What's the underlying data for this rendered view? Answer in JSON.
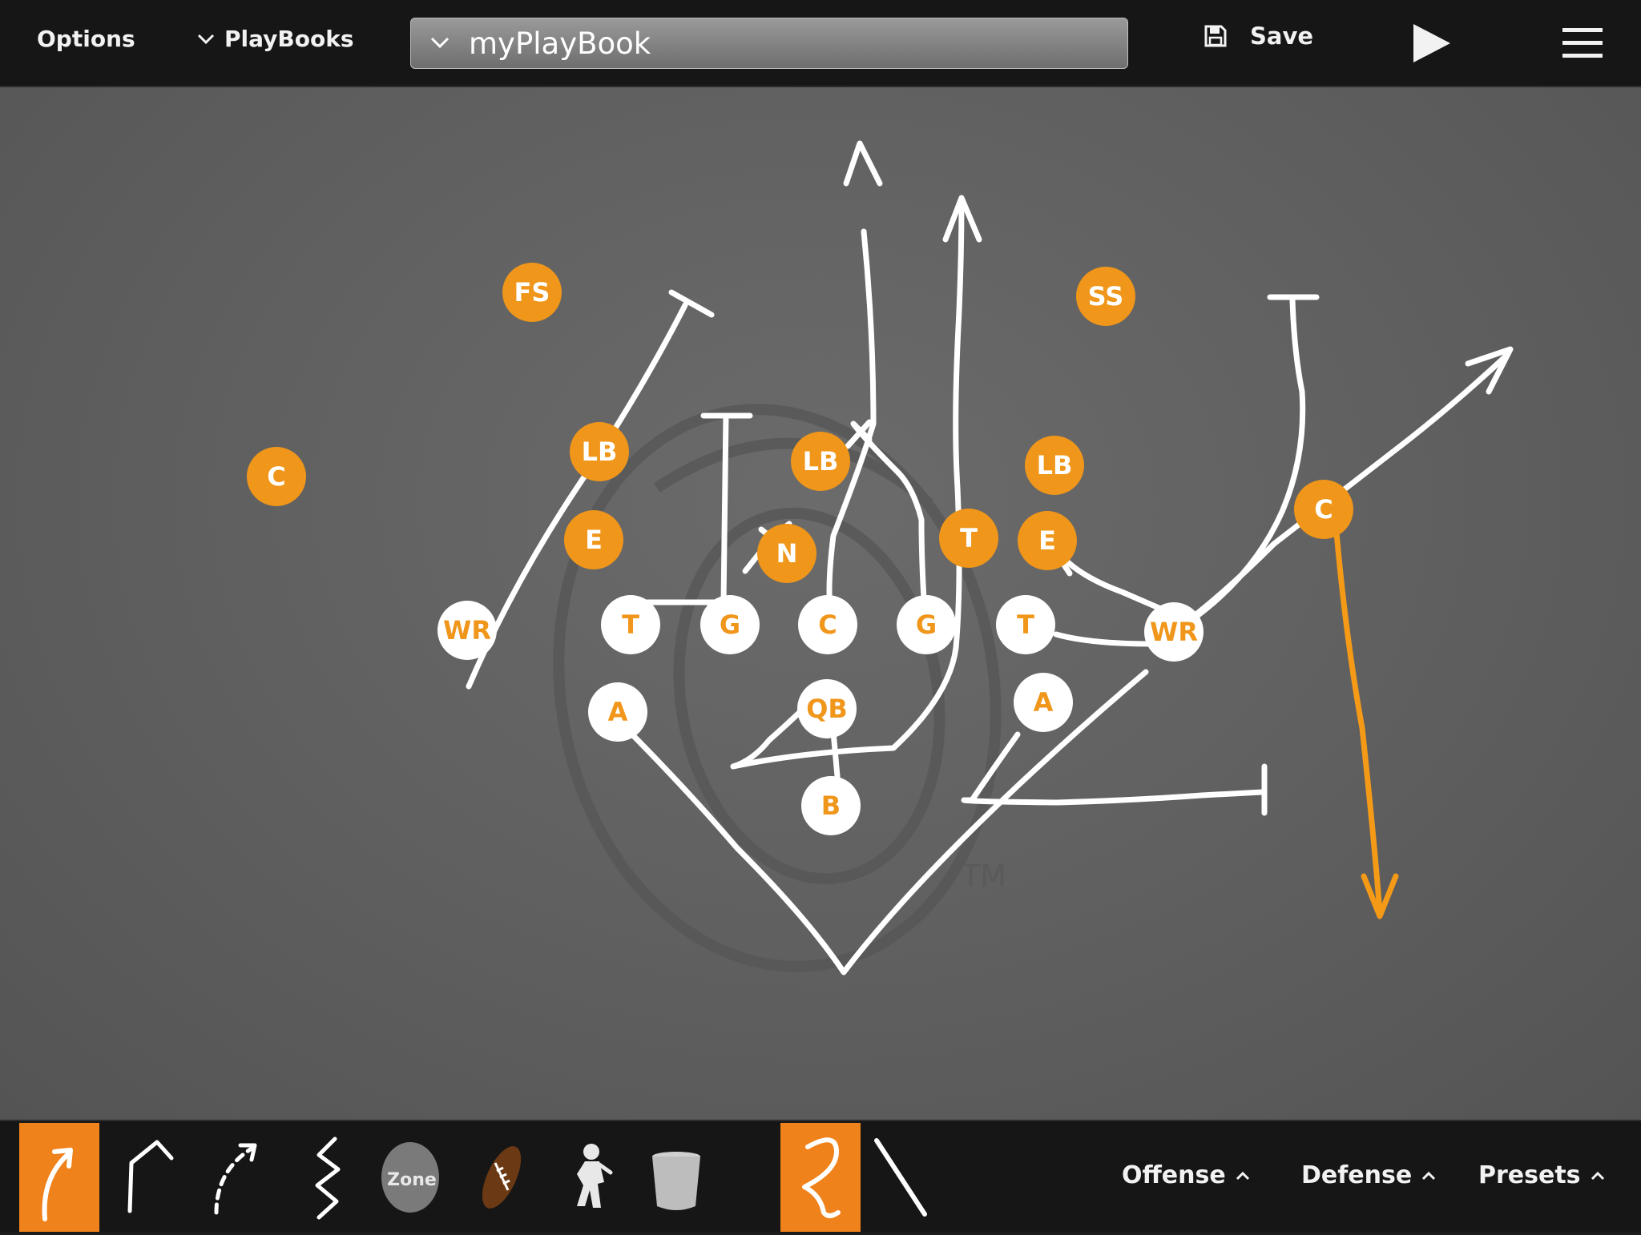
{
  "header": {
    "options_label": "Options",
    "playbooks_label": "PlayBooks",
    "playbook_name": "myPlayBook",
    "save_label": "Save"
  },
  "field": {
    "watermark": "TM",
    "offense": {
      "WR_left": "WR",
      "T_left": "T",
      "G_left": "G",
      "C": "C",
      "G_right": "G",
      "T_right": "T",
      "WR_right": "WR",
      "A_left": "A",
      "QB": "QB",
      "A_right": "A",
      "B": "B"
    },
    "defense": {
      "FS": "FS",
      "SS": "SS",
      "C_left": "C",
      "C_right": "C",
      "LB_left": "LB",
      "LB_mid": "LB",
      "LB_right": "LB",
      "E_left": "E",
      "N": "N",
      "T": "T",
      "E_right": "E"
    }
  },
  "toolbar": {
    "zone_label": "Zone",
    "offense_label": "Offense",
    "defense_label": "Defense",
    "presets_label": "Presets"
  },
  "colors": {
    "accent": "#f0961a",
    "toolbar_active": "#f0821c",
    "route": "#ffffff",
    "defense_route": "#f59a16",
    "board": "#606060"
  }
}
